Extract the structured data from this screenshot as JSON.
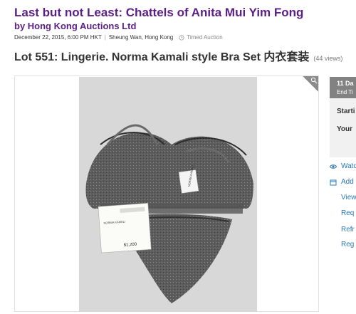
{
  "header": {
    "auction_title": "Last but not Least: Chattels of Anita Mui Yim Fong",
    "auction_house": "by Hong Kong Auctions Ltd",
    "date": "December 22, 2015, 6:00 PM HKT",
    "location": "Sheung Wan, Hong Kong",
    "auction_type": "Timed Auction"
  },
  "lot": {
    "title": "Lot 551: Lingerie. Norma Kamali style Bra Set 内衣套装",
    "views": "(44 views)"
  },
  "tag": {
    "brand": "NORMA KAMALI",
    "price": "$1,200"
  },
  "side_panel": {
    "days": "11 Da",
    "end": "End Ti",
    "starting": "Starti",
    "your": "Your"
  },
  "side_links": {
    "watch": "Watc",
    "add": "Add",
    "view": "View",
    "req1": "Req",
    "refr": "Refr",
    "req2": "Reg"
  },
  "colors": {
    "title_purple": "#5b1f86",
    "link_blue": "#2a78b7",
    "badge_gray": "#828282"
  },
  "icons": [
    "clock-icon",
    "zoom-icon",
    "eye-icon",
    "calendar-icon"
  ]
}
